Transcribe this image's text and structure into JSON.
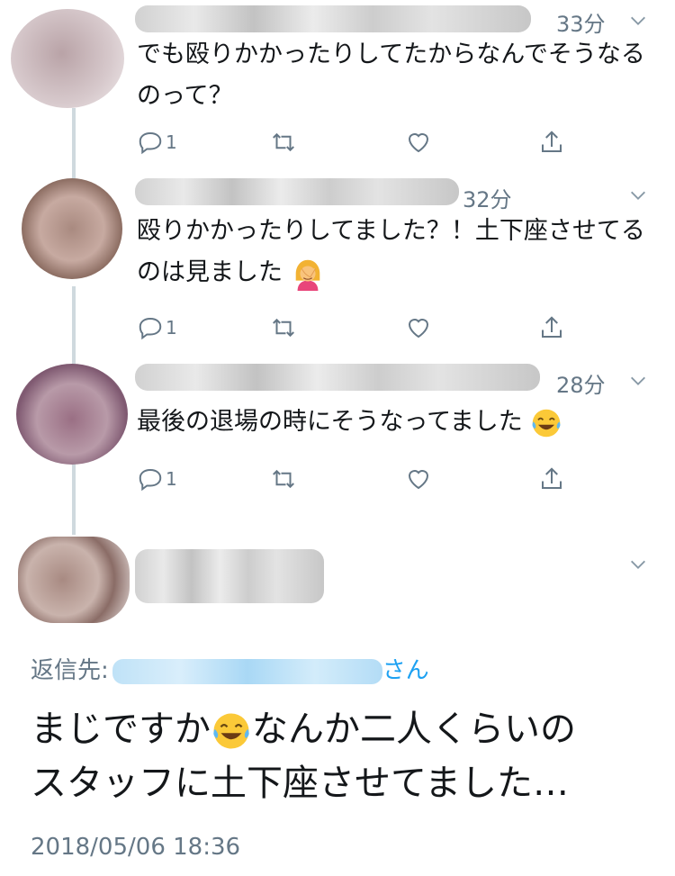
{
  "tweets": [
    {
      "time": "33分",
      "text": "でも殴りかかったりしてたからなんでそうなるのって？",
      "reply_count": "1"
    },
    {
      "time": "32分",
      "text": "殴りかかったりしてました？！土下座させてるのは見ました",
      "reply_count": "1"
    },
    {
      "time": "28分",
      "text": "最後の退場の時にそうなってました",
      "reply_count": "1"
    }
  ],
  "main_tweet": {
    "reply_to_label": "返信先:",
    "reply_to_suffix": "さん",
    "text_line1": "まじですか",
    "text_line1_rest": "なんか二人くらいの",
    "text_line2": "スタッフに土下座させてました…",
    "timestamp": "2018/05/06 18:36"
  },
  "icons": {
    "reply": "reply-icon",
    "retweet": "retweet-icon",
    "like": "heart-icon",
    "share": "share-icon",
    "more": "chevron-down-icon",
    "emoji_facepalm": "facepalm-emoji",
    "emoji_laugh": "tears-of-joy-emoji"
  },
  "colors": {
    "text": "#14171a",
    "secondary": "#657786",
    "link": "#1da1f2",
    "thread_line": "#cfd9de"
  }
}
